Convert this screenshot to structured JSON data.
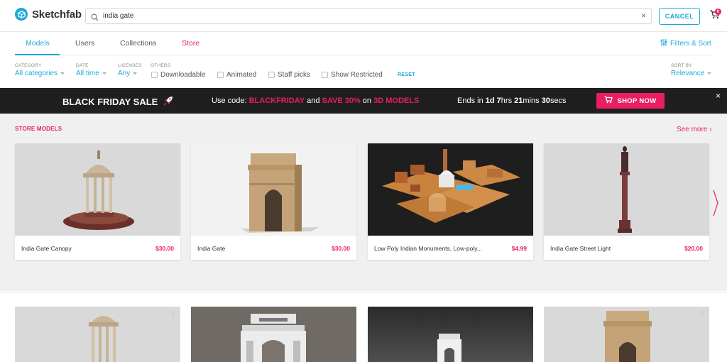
{
  "header": {
    "logo_text": "Sketchfab",
    "search_value": "india gate",
    "clear_icon": "×",
    "cancel_label": "CANCEL",
    "cart_count": "0"
  },
  "tabs": [
    {
      "label": "Models"
    },
    {
      "label": "Users"
    },
    {
      "label": "Collections"
    },
    {
      "label": "Store"
    }
  ],
  "filters_sort_label": "Filters & Sort",
  "filters": {
    "category": {
      "label": "CATEGORY",
      "value": "All categories"
    },
    "date": {
      "label": "DATE",
      "value": "All time"
    },
    "licenses": {
      "label": "LICENSES",
      "value": "Any"
    },
    "others_label": "OTHERS",
    "checkboxes": [
      "Downloadable",
      "Animated",
      "Staff picks",
      "Show Restricted"
    ],
    "reset_label": "RESET",
    "sort": {
      "label": "SORT BY",
      "value": "Relevance"
    }
  },
  "banner": {
    "title": "BLACK FRIDAY SALE",
    "code_prefix": "Use code:",
    "code": "BLACKFRIDAY",
    "and_text": "and",
    "save": "SAVE 30%",
    "on_text": "on",
    "target": "3D MODELS",
    "ends_prefix": "Ends in",
    "days": "1d",
    "hours_num": "7",
    "hours_unit": "hrs",
    "mins_num": "21",
    "mins_unit": "mins",
    "secs_num": "30",
    "secs_unit": "secs",
    "shop_label": "SHOP NOW",
    "close_icon": "×"
  },
  "store": {
    "title": "STORE MODELS",
    "see_more": "See more ›",
    "items": [
      {
        "name": "India Gate Canopy",
        "price": "$30.00"
      },
      {
        "name": "India Gate",
        "price": "$30.00"
      },
      {
        "name": "Low Poly Indian Monuments, Low-poly...",
        "price": "$4.99"
      },
      {
        "name": "India Gate Street Light",
        "price": "$20.00"
      }
    ]
  },
  "colors": {
    "accent": "#1caad9",
    "store_pink": "#e91e63",
    "banner_bg": "#1f1f1f"
  }
}
